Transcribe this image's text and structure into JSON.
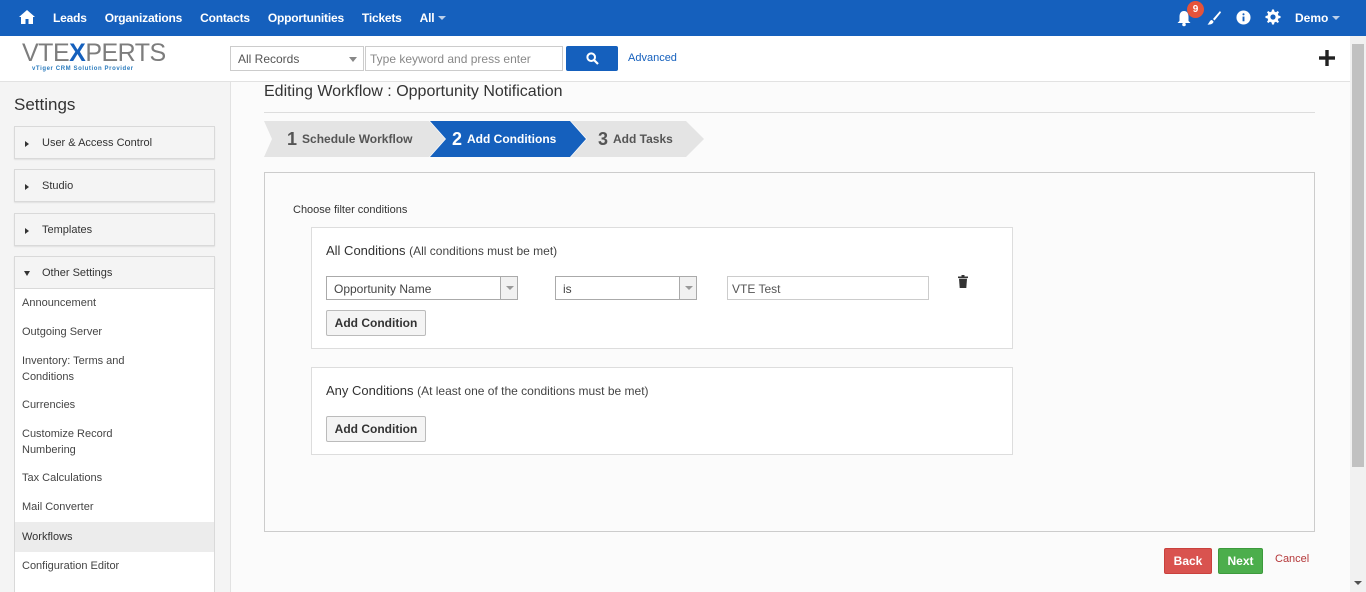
{
  "topnav": {
    "menu": [
      "Leads",
      "Organizations",
      "Contacts",
      "Opportunities",
      "Tickets"
    ],
    "all_label": "All",
    "notification_count": "9",
    "user_name": "Demo"
  },
  "logo": {
    "brand_left": "VTE",
    "brand_x": "X",
    "brand_right": "PERTS",
    "tagline": "vTiger CRM Solution Provider"
  },
  "search": {
    "record_filter": "All Records",
    "placeholder": "Type keyword and press enter",
    "advanced_label": "Advanced"
  },
  "sidebar": {
    "title": "Settings",
    "sections": [
      "User & Access Control",
      "Studio",
      "Templates",
      "Other Settings"
    ],
    "other_items": [
      "Announcement",
      "Outgoing Server",
      "Inventory: Terms and Conditions",
      "Currencies",
      "Customize Record Numbering",
      "Tax Calculations",
      "Mail Converter",
      "Workflows",
      "Configuration Editor"
    ]
  },
  "main": {
    "title": "Editing Workflow : Opportunity Notification",
    "steps": [
      {
        "num": "1",
        "label": "Schedule Workflow"
      },
      {
        "num": "2",
        "label": "Add Conditions"
      },
      {
        "num": "3",
        "label": "Add Tasks"
      }
    ],
    "active_step": 2,
    "choose_label": "Choose filter conditions",
    "all_conditions": {
      "title": "All Conditions",
      "subtitle": "(All conditions must be met)",
      "field": "Opportunity Name",
      "operator": "is",
      "value": "VTE Test",
      "add_label": "Add Condition"
    },
    "any_conditions": {
      "title": "Any Conditions",
      "subtitle": "(At least one of the conditions must be met)",
      "add_label": "Add Condition"
    },
    "back_label": "Back",
    "next_label": "Next",
    "cancel_label": "Cancel"
  },
  "colors": {
    "brand_blue": "#1560bd",
    "back_red": "#d9534f",
    "next_green": "#4cae4c",
    "badge_red": "#e5533a"
  }
}
